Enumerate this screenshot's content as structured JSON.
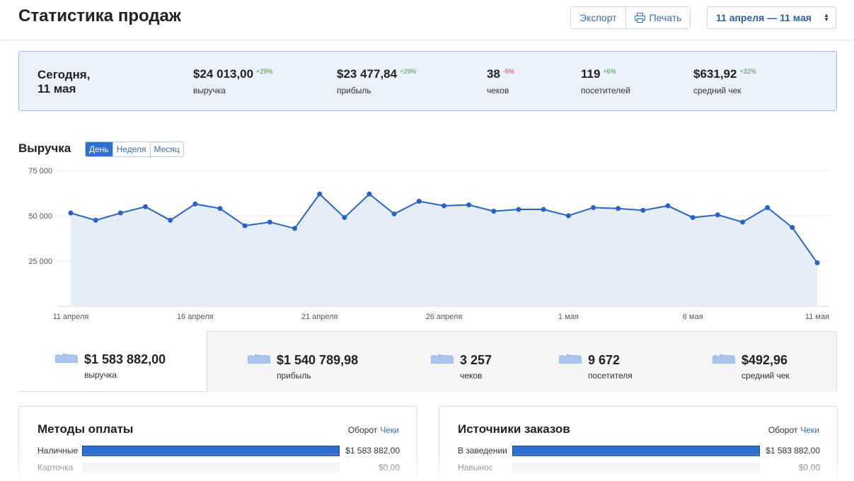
{
  "header": {
    "title": "Статистика продаж",
    "export_label": "Экспорт",
    "print_label": "Печать",
    "date_range": "11 апреля — 11 мая"
  },
  "today": {
    "label_line1": "Сегодня,",
    "label_line2": "11 мая",
    "kpis": [
      {
        "value": "$24 013,00",
        "delta": "+29%",
        "trend": "up",
        "caption": "выручка"
      },
      {
        "value": "$23 477,84",
        "delta": "+29%",
        "trend": "up",
        "caption": "прибыль"
      },
      {
        "value": "38",
        "delta": "-5%",
        "trend": "down",
        "caption": "чеков"
      },
      {
        "value": "119",
        "delta": "+6%",
        "trend": "up",
        "caption": "посетителей"
      },
      {
        "value": "$631,92",
        "delta": "+32%",
        "trend": "up",
        "caption": "средний чек"
      }
    ]
  },
  "revenue": {
    "title": "Выручка",
    "tabs": [
      {
        "label": "День",
        "active": true
      },
      {
        "label": "Неделя",
        "active": false
      },
      {
        "label": "Месяц",
        "active": false
      }
    ]
  },
  "chart_data": {
    "type": "area",
    "title": "Выручка",
    "x": [
      "11 апреля",
      "12 апреля",
      "13 апреля",
      "14 апреля",
      "15 апреля",
      "16 апреля",
      "17 апреля",
      "18 апреля",
      "19 апреля",
      "20 апреля",
      "21 апреля",
      "22 апреля",
      "23 апреля",
      "24 апреля",
      "25 апреля",
      "26 апреля",
      "27 апреля",
      "28 апреля",
      "29 апреля",
      "30 апреля",
      "1 мая",
      "2 мая",
      "3 мая",
      "4 мая",
      "5 мая",
      "6 мая",
      "7 мая",
      "8 мая",
      "9 мая",
      "10 мая",
      "11 мая"
    ],
    "values": [
      51500,
      47500,
      51500,
      55000,
      47500,
      56500,
      54000,
      44500,
      46500,
      43000,
      62000,
      49000,
      62000,
      51000,
      58000,
      55500,
      56000,
      52500,
      53500,
      53500,
      50000,
      54500,
      54000,
      53000,
      55500,
      49000,
      50500,
      46500,
      54500,
      43500,
      24000
    ],
    "xticks": [
      {
        "label": "11 апреля",
        "index": 0
      },
      {
        "label": "16 апреля",
        "index": 5
      },
      {
        "label": "21 апреля",
        "index": 10
      },
      {
        "label": "26 апреля",
        "index": 15
      },
      {
        "label": "1 мая",
        "index": 20
      },
      {
        "label": "6 мая",
        "index": 25
      },
      {
        "label": "11 мая",
        "index": 30
      }
    ],
    "yticks": [
      "25 000",
      "50 000",
      "75 000"
    ],
    "ytick_values": [
      25000,
      50000,
      75000
    ],
    "ylim": [
      0,
      75000
    ],
    "grid": true,
    "line_color": "#2563c9",
    "fill_color": "#e5edf9"
  },
  "totals": [
    {
      "value": "$1 583 882,00",
      "caption": "выручка"
    },
    {
      "value": "$1 540 789,98",
      "caption": "прибыль"
    },
    {
      "value": "3 257",
      "caption": "чеков"
    },
    {
      "value": "9 672",
      "caption": "посетителя"
    },
    {
      "value": "$492,96",
      "caption": "средний чек"
    }
  ],
  "payment_methods": {
    "title": "Методы оплаты",
    "toggle_a": "Оборот",
    "toggle_b": "Чеки",
    "rows": [
      {
        "label": "Наличные",
        "amount": "$1 583 882,00",
        "share": 1.0
      },
      {
        "label": "Карточка",
        "amount": "$0,00",
        "share": 0.0
      }
    ]
  },
  "order_sources": {
    "title": "Источники заказов",
    "toggle_a": "Оборот",
    "toggle_b": "Чеки",
    "rows": [
      {
        "label": "В заведении",
        "amount": "$1 583 882,00",
        "share": 1.0
      },
      {
        "label": "Навынос",
        "amount": "$0,00",
        "share": 0.0
      }
    ]
  },
  "colors": {
    "accent": "#2f6fd0",
    "positive": "#3a9a3a",
    "negative": "#d9413b"
  }
}
